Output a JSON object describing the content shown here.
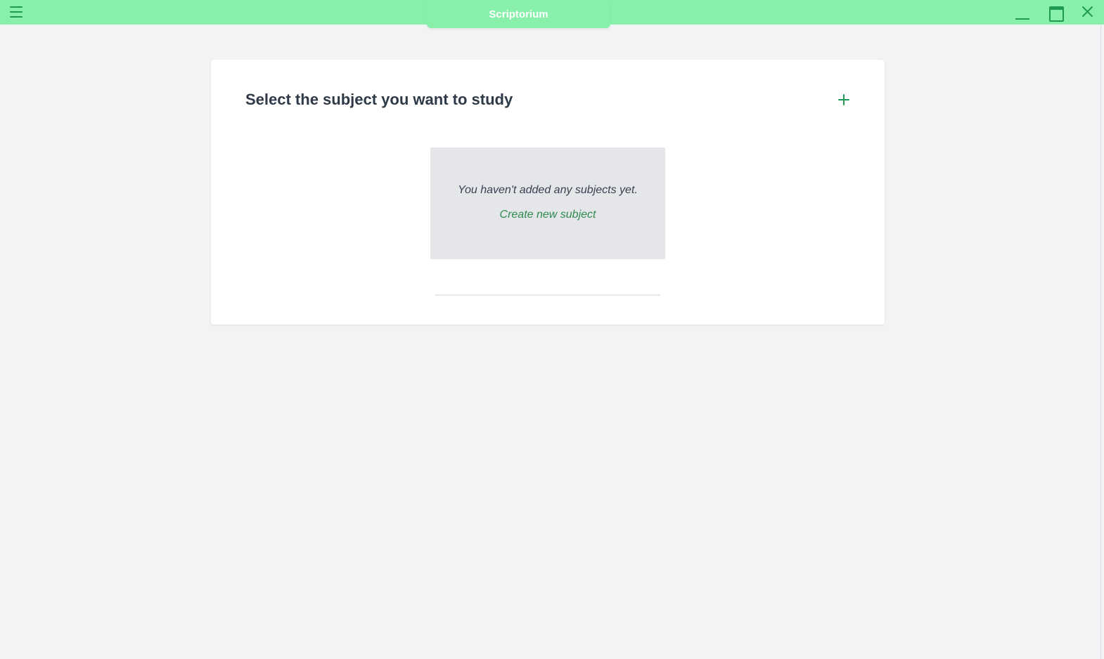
{
  "window": {
    "title": "Scriptorium",
    "accent_color": "#88f0aa",
    "icon_color": "#1e9a52"
  },
  "titlebar": {
    "menu_icon": "hamburger-menu-icon",
    "controls": [
      "minimize-icon",
      "maximize-icon",
      "close-icon"
    ]
  },
  "main": {
    "heading": "Select the subject you want to study",
    "add_icon": "plus-icon",
    "empty_state": {
      "message": "You haven't added any subjects yet.",
      "link_label": "Create new subject"
    }
  }
}
